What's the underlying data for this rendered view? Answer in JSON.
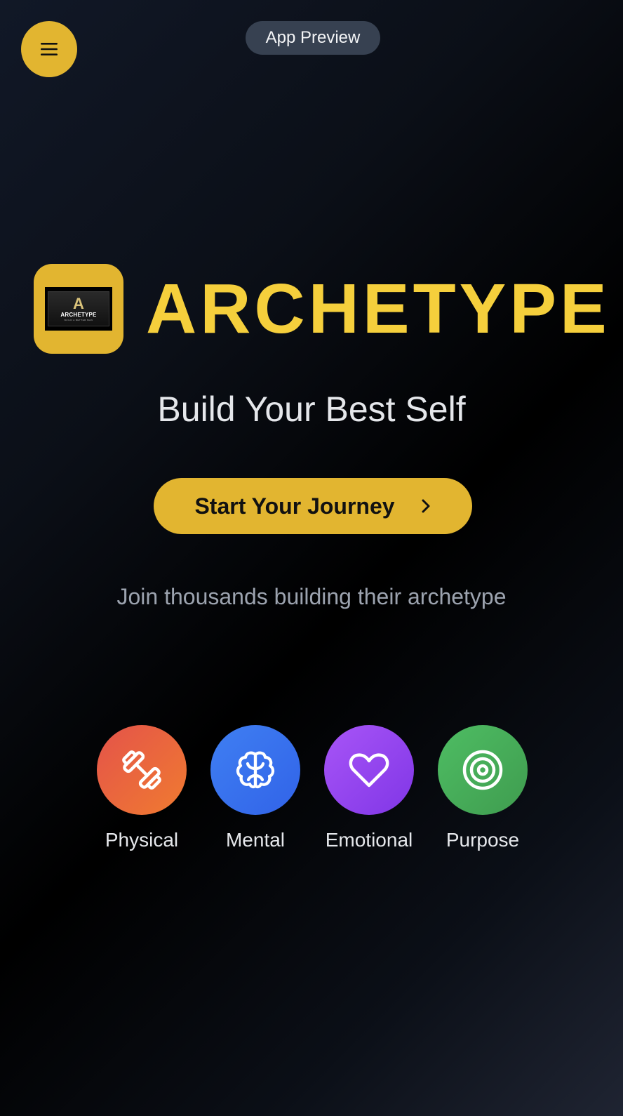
{
  "header": {
    "menu_icon": "hamburger-menu-icon",
    "preview_label": "App Preview"
  },
  "brand": {
    "logo": {
      "letter": "A",
      "word": "ARCHETYPE",
      "tagline": "BUILD A BETTER MAN"
    },
    "name": "ARCHETYPE"
  },
  "hero": {
    "headline": "Build Your Best Self",
    "cta_label": "Start Your Journey",
    "cta_icon": "chevron-right-icon",
    "subtext": "Join thousands building their archetype"
  },
  "categories": [
    {
      "label": "Physical",
      "icon": "dumbbell-icon",
      "color": "#e9653d"
    },
    {
      "label": "Mental",
      "icon": "brain-icon",
      "color": "#3a72ef"
    },
    {
      "label": "Emotional",
      "icon": "heart-icon",
      "color": "#9446ee"
    },
    {
      "label": "Purpose",
      "icon": "target-icon",
      "color": "#47ad59"
    }
  ],
  "colors": {
    "accent": "#e2b530",
    "brand_text": "#f5cf3c",
    "background": "#000000"
  }
}
